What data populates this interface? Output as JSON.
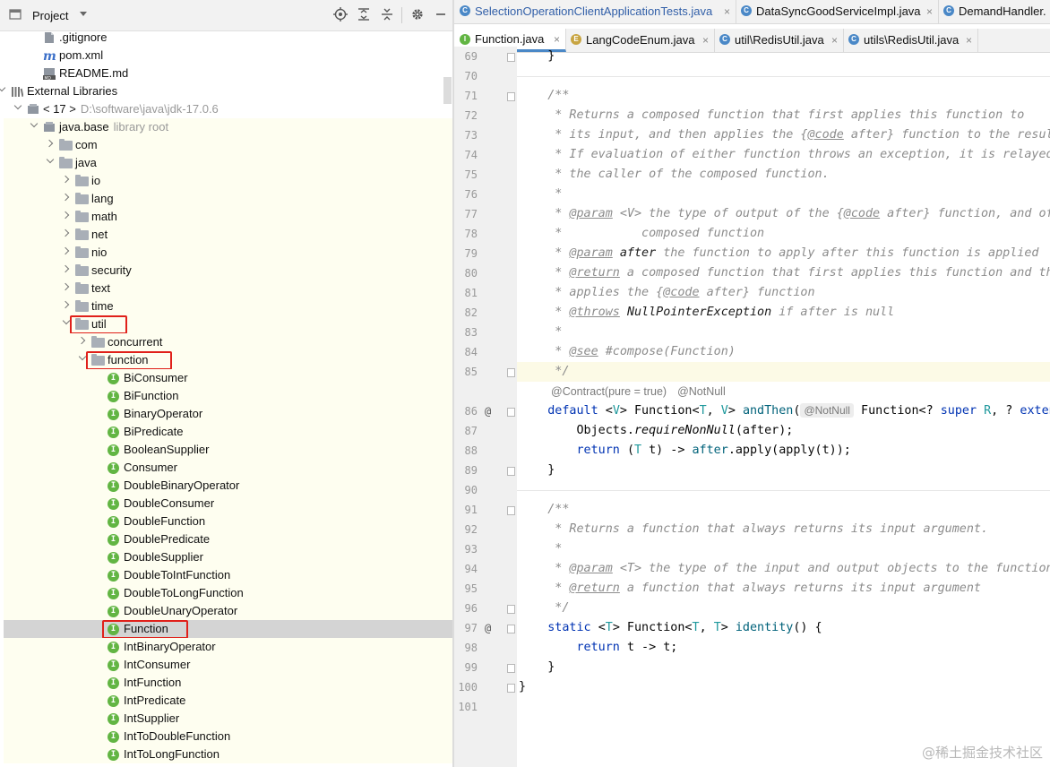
{
  "project": {
    "title": "Project",
    "header_icons": [
      "locate-icon",
      "expand-all-icon",
      "collapse-all-icon",
      "gear-icon",
      "minimize-icon"
    ],
    "tree": [
      {
        "label": ".gitignore",
        "icon": "gitignore-file-icon",
        "depth": 2,
        "arrow": "none",
        "kind": "file"
      },
      {
        "label": "pom.xml",
        "icon": "maven-file-icon",
        "depth": 2,
        "arrow": "none",
        "kind": "file"
      },
      {
        "label": "README.md",
        "icon": "markdown-file-icon",
        "depth": 2,
        "arrow": "none",
        "kind": "file"
      },
      {
        "label": "External Libraries",
        "icon": "libraries-icon",
        "depth": 0,
        "arrow": "down",
        "kind": "libs"
      },
      {
        "label": "< 17 >",
        "hint": "D:\\software\\java\\jdk-17.0.6",
        "icon": "jdk-icon",
        "depth": 1,
        "arrow": "down",
        "kind": "jdk"
      },
      {
        "label": "java.base",
        "hint": "library root",
        "icon": "module-icon",
        "depth": 2,
        "arrow": "down",
        "kind": "module"
      },
      {
        "label": "com",
        "icon": "folder-icon",
        "depth": 3,
        "arrow": "right",
        "kind": "folder"
      },
      {
        "label": "java",
        "icon": "folder-icon",
        "depth": 3,
        "arrow": "down",
        "kind": "folder"
      },
      {
        "label": "io",
        "icon": "folder-icon",
        "depth": 4,
        "arrow": "right",
        "kind": "folder"
      },
      {
        "label": "lang",
        "icon": "folder-icon",
        "depth": 4,
        "arrow": "right",
        "kind": "folder"
      },
      {
        "label": "math",
        "icon": "folder-icon",
        "depth": 4,
        "arrow": "right",
        "kind": "folder"
      },
      {
        "label": "net",
        "icon": "folder-icon",
        "depth": 4,
        "arrow": "right",
        "kind": "folder"
      },
      {
        "label": "nio",
        "icon": "folder-icon",
        "depth": 4,
        "arrow": "right",
        "kind": "folder"
      },
      {
        "label": "security",
        "icon": "folder-icon",
        "depth": 4,
        "arrow": "right",
        "kind": "folder"
      },
      {
        "label": "text",
        "icon": "folder-icon",
        "depth": 4,
        "arrow": "right",
        "kind": "folder"
      },
      {
        "label": "time",
        "icon": "folder-icon",
        "depth": 4,
        "arrow": "right",
        "kind": "folder"
      },
      {
        "label": "util",
        "icon": "folder-icon",
        "depth": 4,
        "arrow": "down",
        "kind": "folder",
        "boxed": true
      },
      {
        "label": "concurrent",
        "icon": "folder-icon",
        "depth": 5,
        "arrow": "right",
        "kind": "folder"
      },
      {
        "label": "function",
        "icon": "folder-icon",
        "depth": 5,
        "arrow": "down",
        "kind": "folder",
        "boxed": true
      },
      {
        "label": "BiConsumer",
        "icon": "interface-icon",
        "depth": 6,
        "arrow": "none",
        "kind": "iface"
      },
      {
        "label": "BiFunction",
        "icon": "interface-icon",
        "depth": 6,
        "arrow": "none",
        "kind": "iface"
      },
      {
        "label": "BinaryOperator",
        "icon": "interface-icon",
        "depth": 6,
        "arrow": "none",
        "kind": "iface"
      },
      {
        "label": "BiPredicate",
        "icon": "interface-icon",
        "depth": 6,
        "arrow": "none",
        "kind": "iface"
      },
      {
        "label": "BooleanSupplier",
        "icon": "interface-icon",
        "depth": 6,
        "arrow": "none",
        "kind": "iface"
      },
      {
        "label": "Consumer",
        "icon": "interface-icon",
        "depth": 6,
        "arrow": "none",
        "kind": "iface"
      },
      {
        "label": "DoubleBinaryOperator",
        "icon": "interface-icon",
        "depth": 6,
        "arrow": "none",
        "kind": "iface"
      },
      {
        "label": "DoubleConsumer",
        "icon": "interface-icon",
        "depth": 6,
        "arrow": "none",
        "kind": "iface"
      },
      {
        "label": "DoubleFunction",
        "icon": "interface-icon",
        "depth": 6,
        "arrow": "none",
        "kind": "iface"
      },
      {
        "label": "DoublePredicate",
        "icon": "interface-icon",
        "depth": 6,
        "arrow": "none",
        "kind": "iface"
      },
      {
        "label": "DoubleSupplier",
        "icon": "interface-icon",
        "depth": 6,
        "arrow": "none",
        "kind": "iface"
      },
      {
        "label": "DoubleToIntFunction",
        "icon": "interface-icon",
        "depth": 6,
        "arrow": "none",
        "kind": "iface"
      },
      {
        "label": "DoubleToLongFunction",
        "icon": "interface-icon",
        "depth": 6,
        "arrow": "none",
        "kind": "iface"
      },
      {
        "label": "DoubleUnaryOperator",
        "icon": "interface-icon",
        "depth": 6,
        "arrow": "none",
        "kind": "iface"
      },
      {
        "label": "Function",
        "icon": "interface-icon",
        "depth": 6,
        "arrow": "none",
        "kind": "iface",
        "boxed": true,
        "selected": true
      },
      {
        "label": "IntBinaryOperator",
        "icon": "interface-icon",
        "depth": 6,
        "arrow": "none",
        "kind": "iface"
      },
      {
        "label": "IntConsumer",
        "icon": "interface-icon",
        "depth": 6,
        "arrow": "none",
        "kind": "iface"
      },
      {
        "label": "IntFunction",
        "icon": "interface-icon",
        "depth": 6,
        "arrow": "none",
        "kind": "iface"
      },
      {
        "label": "IntPredicate",
        "icon": "interface-icon",
        "depth": 6,
        "arrow": "none",
        "kind": "iface"
      },
      {
        "label": "IntSupplier",
        "icon": "interface-icon",
        "depth": 6,
        "arrow": "none",
        "kind": "iface"
      },
      {
        "label": "IntToDoubleFunction",
        "icon": "interface-icon",
        "depth": 6,
        "arrow": "none",
        "kind": "iface"
      },
      {
        "label": "IntToLongFunction",
        "icon": "interface-icon",
        "depth": 6,
        "arrow": "none",
        "kind": "iface"
      }
    ]
  },
  "editor": {
    "tabs_row1": [
      {
        "label": "SelectionOperationClientApplicationTests.java",
        "icon": "class-icon",
        "close": "×"
      },
      {
        "label": "DataSyncGoodServiceImpl.java",
        "icon": "class-icon",
        "close": "×"
      },
      {
        "label": "DemandHandler.",
        "icon": "class-icon",
        "close": ""
      }
    ],
    "tabs_row2": [
      {
        "label": "Function.java",
        "icon": "interface-icon",
        "close": "×",
        "active": true
      },
      {
        "label": "LangCodeEnum.java",
        "icon": "enum-icon",
        "close": "×"
      },
      {
        "label": "util\\RedisUtil.java",
        "icon": "class-icon",
        "close": "×"
      },
      {
        "label": "utils\\RedisUtil.java",
        "icon": "class-icon",
        "close": "×"
      }
    ],
    "inlay_contract": "@Contract(pure = true)",
    "inlay_notnull": "@NotNull",
    "inlay_param_notnull": "@NotNull",
    "lines": [
      {
        "n": "69",
        "t": [
          [
            "plain",
            "    }"
          ]
        ]
      },
      {
        "n": "70",
        "t": []
      },
      {
        "n": "71",
        "t": [
          [
            "doc",
            "    /**"
          ]
        ]
      },
      {
        "n": "72",
        "t": [
          [
            "doc",
            "     * Returns a composed function that first applies this function to"
          ]
        ]
      },
      {
        "n": "73",
        "t": [
          [
            "doc",
            "     * its input, and then applies the {"
          ],
          [
            "tag",
            "@code"
          ],
          [
            "doc",
            " after} function to the result."
          ]
        ]
      },
      {
        "n": "74",
        "t": [
          [
            "doc",
            "     * If evaluation of either function throws an exception, it is relayed to"
          ]
        ]
      },
      {
        "n": "75",
        "t": [
          [
            "doc",
            "     * the caller of the composed function."
          ]
        ]
      },
      {
        "n": "76",
        "t": [
          [
            "doc",
            "     *"
          ]
        ]
      },
      {
        "n": "77",
        "t": [
          [
            "doc",
            "     * "
          ],
          [
            "tag",
            "@param"
          ],
          [
            "doc",
            " <V> the type of output of the {"
          ],
          [
            "tag",
            "@code"
          ],
          [
            "doc",
            " after} function, and of the"
          ]
        ]
      },
      {
        "n": "78",
        "t": [
          [
            "doc",
            "     *           composed function"
          ]
        ]
      },
      {
        "n": "79",
        "t": [
          [
            "doc",
            "     * "
          ],
          [
            "tag",
            "@param"
          ],
          [
            "doc",
            " "
          ],
          [
            "plaindoc",
            "after"
          ],
          [
            "doc",
            " the function to apply after this function is applied"
          ]
        ]
      },
      {
        "n": "80",
        "t": [
          [
            "doc",
            "     * "
          ],
          [
            "tag",
            "@return"
          ],
          [
            "doc",
            " a composed function that first applies this function and then"
          ]
        ]
      },
      {
        "n": "81",
        "t": [
          [
            "doc",
            "     * applies the {"
          ],
          [
            "tag",
            "@code"
          ],
          [
            "doc",
            " after} function"
          ]
        ]
      },
      {
        "n": "82",
        "t": [
          [
            "doc",
            "     * "
          ],
          [
            "tag",
            "@throws"
          ],
          [
            "doc",
            " "
          ],
          [
            "plaindoc",
            "NullPointerException"
          ],
          [
            "doc",
            " if after is null"
          ]
        ]
      },
      {
        "n": "83",
        "t": [
          [
            "doc",
            "     *"
          ]
        ]
      },
      {
        "n": "84",
        "t": [
          [
            "doc",
            "     * "
          ],
          [
            "tag",
            "@see"
          ],
          [
            "doc",
            " #compose(Function)"
          ]
        ]
      },
      {
        "n": "85",
        "t": [
          [
            "doc",
            "     */"
          ]
        ]
      },
      {
        "n": "86",
        "t": [
          [
            "kw",
            "    default "
          ],
          [
            "plain",
            "<"
          ],
          [
            "tv",
            "V"
          ],
          [
            "plain",
            "> Function<"
          ],
          [
            "tv",
            "T"
          ],
          [
            "plain",
            ", "
          ],
          [
            "tv",
            "V"
          ],
          [
            "plain",
            "> "
          ],
          [
            "mth",
            "andThen"
          ],
          [
            "plain",
            "("
          ],
          [
            "chip",
            "@NotNull"
          ],
          [
            "plain",
            " Function<? "
          ],
          [
            "kw",
            "super "
          ],
          [
            "tv",
            "R"
          ],
          [
            "plain",
            ", ? "
          ],
          [
            "kw",
            "extends "
          ],
          [
            "tv",
            "V"
          ],
          [
            "plain",
            "> after) {"
          ]
        ]
      },
      {
        "n": "87",
        "t": [
          [
            "plain",
            "        Objects."
          ],
          [
            "itl",
            "requireNonNull"
          ],
          [
            "plain",
            "(after);"
          ]
        ]
      },
      {
        "n": "88",
        "t": [
          [
            "kw",
            "        return "
          ],
          [
            "plain",
            "("
          ],
          [
            "tv",
            "T"
          ],
          [
            "plain",
            " t) -> "
          ],
          [
            "mth",
            "after"
          ],
          [
            "plain",
            ".apply(apply(t));"
          ]
        ]
      },
      {
        "n": "89",
        "t": [
          [
            "plain",
            "    }"
          ]
        ]
      },
      {
        "n": "90",
        "t": []
      },
      {
        "n": "91",
        "t": [
          [
            "doc",
            "    /**"
          ]
        ]
      },
      {
        "n": "92",
        "t": [
          [
            "doc",
            "     * Returns a function that always returns its input argument."
          ]
        ]
      },
      {
        "n": "93",
        "t": [
          [
            "doc",
            "     *"
          ]
        ]
      },
      {
        "n": "94",
        "t": [
          [
            "doc",
            "     * "
          ],
          [
            "tag",
            "@param"
          ],
          [
            "doc",
            " <T> the type of the input and output objects to the function"
          ]
        ]
      },
      {
        "n": "95",
        "t": [
          [
            "doc",
            "     * "
          ],
          [
            "tag",
            "@return"
          ],
          [
            "doc",
            " a function that always returns its input argument"
          ]
        ]
      },
      {
        "n": "96",
        "t": [
          [
            "doc",
            "     */"
          ]
        ]
      },
      {
        "n": "97",
        "t": [
          [
            "kw",
            "    static "
          ],
          [
            "plain",
            "<"
          ],
          [
            "tv",
            "T"
          ],
          [
            "plain",
            "> Function<"
          ],
          [
            "tv",
            "T"
          ],
          [
            "plain",
            ", "
          ],
          [
            "tv",
            "T"
          ],
          [
            "plain",
            "> "
          ],
          [
            "mth",
            "identity"
          ],
          [
            "plain",
            "() {"
          ]
        ]
      },
      {
        "n": "98",
        "t": [
          [
            "kw",
            "        return "
          ],
          [
            "plain",
            "t -> t;"
          ]
        ]
      },
      {
        "n": "99",
        "t": [
          [
            "plain",
            "    }"
          ]
        ]
      },
      {
        "n": "100",
        "t": [
          [
            "plain",
            "}"
          ]
        ]
      },
      {
        "n": "101",
        "t": []
      }
    ]
  },
  "watermark": "@稀土掘金技术社区"
}
